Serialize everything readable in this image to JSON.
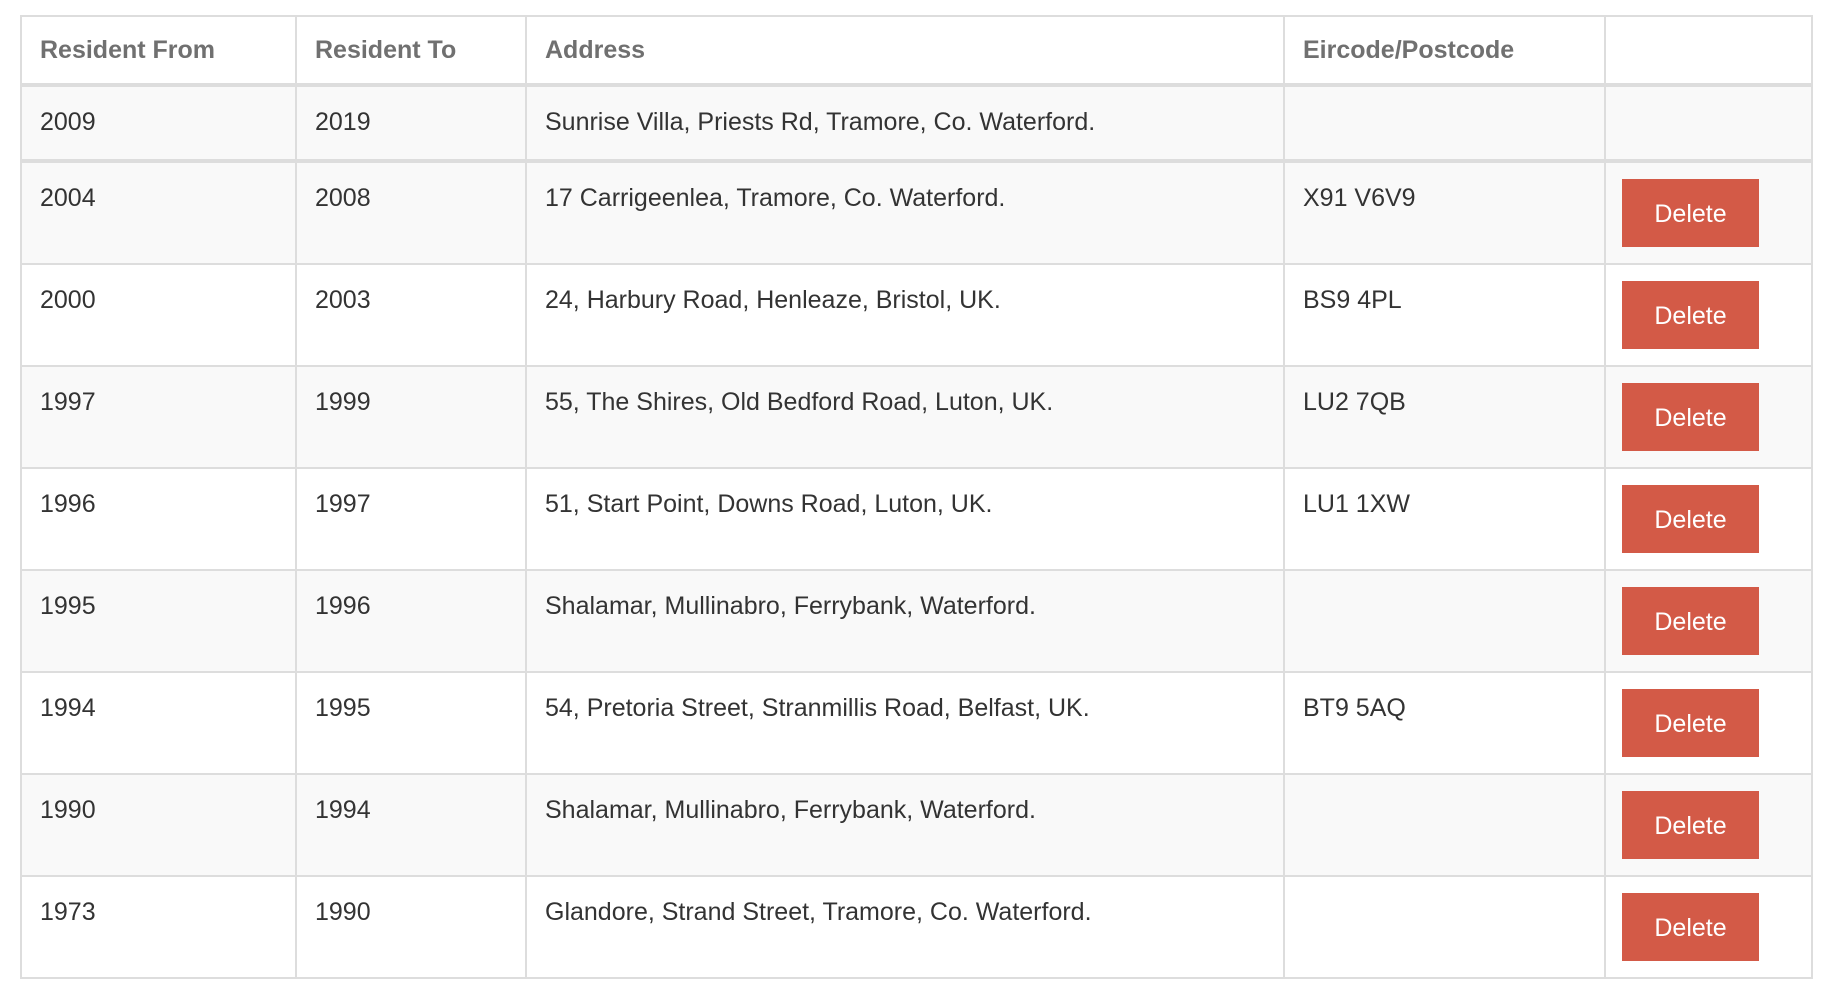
{
  "colors": {
    "accent": "#d35a47",
    "header_text": "#707070",
    "border": "#dddddd",
    "stripe": "#f9f9f9"
  },
  "headers": [
    "Resident From",
    "Resident To",
    "Address",
    "Eircode/Postcode",
    ""
  ],
  "current": {
    "from": "2009",
    "to": "2019",
    "address": "Sunrise Villa, Priests Rd, Tramore, Co. Waterford.",
    "postcode": ""
  },
  "delete_label": "Delete",
  "rows": [
    {
      "from": "2004",
      "to": "2008",
      "address": "17 Carrigeenlea, Tramore, Co. Waterford.",
      "postcode": "X91 V6V9"
    },
    {
      "from": "2000",
      "to": "2003",
      "address": "24, Harbury Road, Henleaze, Bristol, UK.",
      "postcode": "BS9 4PL"
    },
    {
      "from": "1997",
      "to": "1999",
      "address": "55, The Shires, Old Bedford Road, Luton, UK.",
      "postcode": "LU2 7QB"
    },
    {
      "from": "1996",
      "to": "1997",
      "address": "51, Start Point, Downs Road, Luton, UK.",
      "postcode": "LU1 1XW"
    },
    {
      "from": "1995",
      "to": "1996",
      "address": "Shalamar, Mullinabro, Ferrybank, Waterford.",
      "postcode": ""
    },
    {
      "from": "1994",
      "to": "1995",
      "address": "54, Pretoria Street, Stranmillis Road, Belfast, UK.",
      "postcode": "BT9 5AQ"
    },
    {
      "from": "1990",
      "to": "1994",
      "address": "Shalamar, Mullinabro, Ferrybank, Waterford.",
      "postcode": ""
    },
    {
      "from": "1973",
      "to": "1990",
      "address": "Glandore, Strand Street, Tramore, Co. Waterford.",
      "postcode": ""
    }
  ]
}
